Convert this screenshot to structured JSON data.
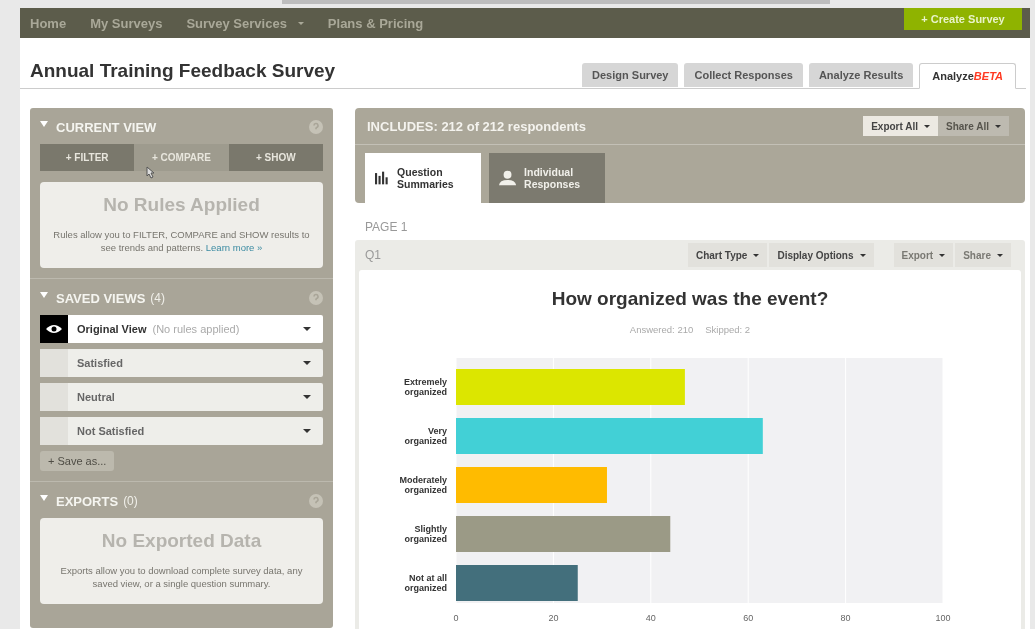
{
  "nav": {
    "items": [
      {
        "label": "Home",
        "dropdown": false
      },
      {
        "label": "My Surveys",
        "dropdown": false
      },
      {
        "label": "Survey Services",
        "dropdown": true
      },
      {
        "label": "Plans & Pricing",
        "dropdown": false
      }
    ],
    "create_button": "+ Create Survey"
  },
  "title": "Annual Training Feedback Survey",
  "tabs": [
    {
      "label": "Design Survey",
      "selected": false
    },
    {
      "label": "Collect Responses",
      "selected": false
    },
    {
      "label": "Analyze Results",
      "selected": false
    },
    {
      "label": "Analyze",
      "badge": "BETA",
      "selected": true
    }
  ],
  "sidebar": {
    "current_view": {
      "title": "CURRENT VIEW",
      "buttons": [
        {
          "label": "+ FILTER",
          "hovered": false
        },
        {
          "label": "+ COMPARE",
          "hovered": true
        },
        {
          "label": "+ SHOW",
          "hovered": false
        }
      ],
      "empty_title": "No Rules Applied",
      "empty_text": "Rules allow you to **FILTER, COMPARE** and **SHOW** results to see trends and patterns.",
      "link": "Learn more »"
    },
    "saved_views": {
      "title": "SAVED VIEWS",
      "count": "(4)",
      "items": [
        {
          "name": "Original View",
          "note": "(No rules applied)",
          "selected": true
        },
        {
          "name": "Satisfied",
          "selected": false
        },
        {
          "name": "Neutral",
          "selected": false
        },
        {
          "name": "Not Satisfied",
          "selected": false
        }
      ],
      "save_button": "+ Save as..."
    },
    "exports": {
      "title": "EXPORTS",
      "count": "(0)",
      "empty_title": "No Exported Data",
      "empty_text": "Exports allow you to download complete survey data, any saved view, or a single question summary."
    }
  },
  "results": {
    "includes": "INCLUDES: 212 of 212 respondents",
    "actions": [
      {
        "label": "Export All",
        "disabled": false
      },
      {
        "label": "Share All",
        "disabled": true
      }
    ],
    "view_tabs": [
      {
        "label": "Question Summaries",
        "selected": true
      },
      {
        "label": "Individual Responses",
        "selected": false
      }
    ],
    "page": "PAGE 1",
    "question": {
      "number": "Q1",
      "tools": [
        {
          "label": "Chart Type",
          "disabled": false
        },
        {
          "label": "Display Options",
          "disabled": false
        },
        {
          "label": "Export",
          "disabled": true
        },
        {
          "label": "Share",
          "disabled": true
        }
      ],
      "title": "How organized was the event?",
      "answered": "Answered: 210",
      "skipped": "Skipped: 2",
      "chart_data": {
        "type": "bar",
        "orientation": "horizontal",
        "categories": [
          "Extremely organized",
          "Very organized",
          "Moderately organized",
          "Slightly organized",
          "Not at all organized"
        ],
        "values": [
          47,
          63,
          31,
          44,
          25
        ],
        "colors": [
          "#dce600",
          "#42d0d6",
          "#ffbb00",
          "#9b9a86",
          "#436f7c"
        ],
        "grid": true,
        "xlim": [
          0,
          100
        ],
        "xticks": [
          0,
          20,
          40,
          60,
          80,
          100
        ]
      }
    }
  }
}
